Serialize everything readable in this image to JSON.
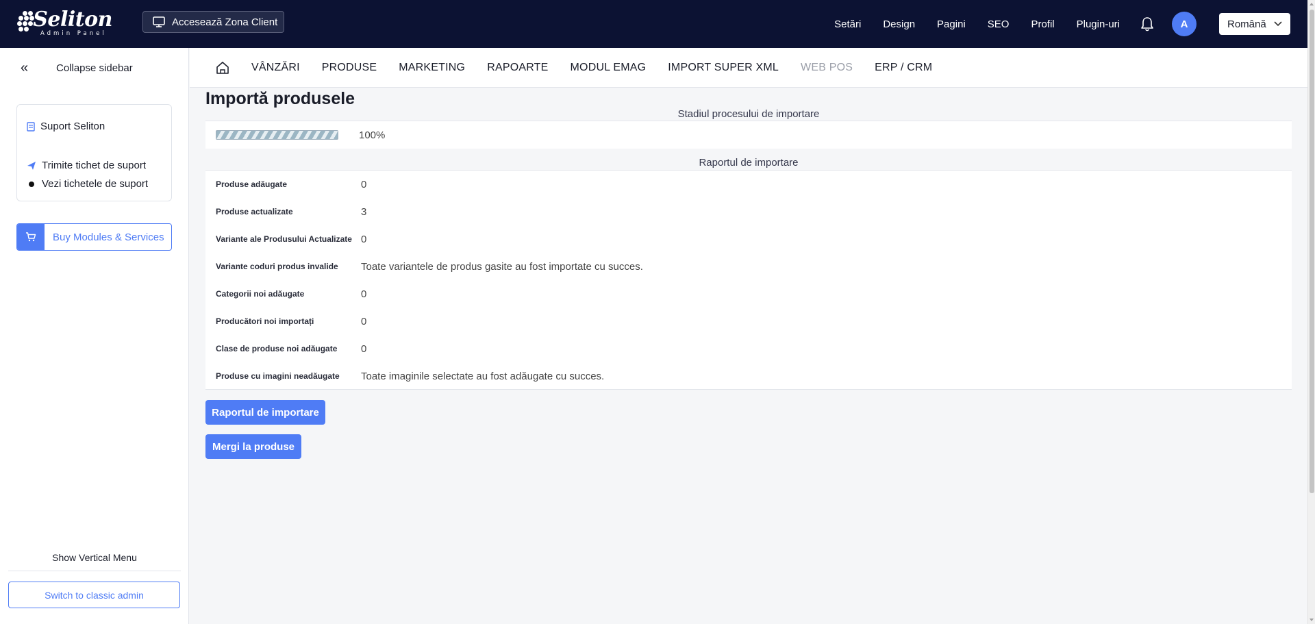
{
  "brand": {
    "name": "Seliton",
    "subtitle": "Admin Panel"
  },
  "header": {
    "client_button": "Accesează Zona Client",
    "nav": [
      "Setări",
      "Design",
      "Pagini",
      "SEO",
      "Profil",
      "Plugin-uri"
    ],
    "avatar_initial": "A",
    "language": "Română"
  },
  "sidebar": {
    "collapse_label": "Collapse sidebar",
    "support_title": "Suport Seliton",
    "support_items": [
      "Trimite tichet de suport",
      "Vezi tichetele de suport"
    ],
    "buy_button": "Buy Modules & Services",
    "show_vertical_menu": "Show Vertical Menu",
    "switch_classic": "Switch to classic admin"
  },
  "subnav": {
    "items": [
      "VÂNZĂRI",
      "PRODUSE",
      "MARKETING",
      "RAPOARTE",
      "MODUL EMAG",
      "IMPORT SUPER XML",
      "WEB POS",
      "ERP / CRM"
    ]
  },
  "main": {
    "title": "Importă produsele",
    "progress_heading": "Stadiul procesului de importare",
    "progress_value": "100%",
    "progress_fraction": 1.0,
    "report_heading": "Raportul de importare",
    "report_rows": [
      {
        "label": "Produse adăugate",
        "value": "0"
      },
      {
        "label": "Produse actualizate",
        "value": "3"
      },
      {
        "label": "Variante ale Produsului Actualizate",
        "value": "0"
      },
      {
        "label": "Variante coduri produs invalide",
        "value": "Toate variantele de produs gasite au fost importate cu succes."
      },
      {
        "label": "Categorii noi adăugate",
        "value": "0"
      },
      {
        "label": "Producători noi importați",
        "value": "0"
      },
      {
        "label": "Clase de produse noi adăugate",
        "value": "0"
      },
      {
        "label": "Produse cu imagini neadăugate",
        "value": "Toate imaginile selectate au fost adăugate cu succes."
      }
    ],
    "report_button": "Raportul de importare",
    "products_button": "Mergi la produse"
  },
  "colors": {
    "header_bg": "#0c1233",
    "accent": "#4f7cf5"
  }
}
